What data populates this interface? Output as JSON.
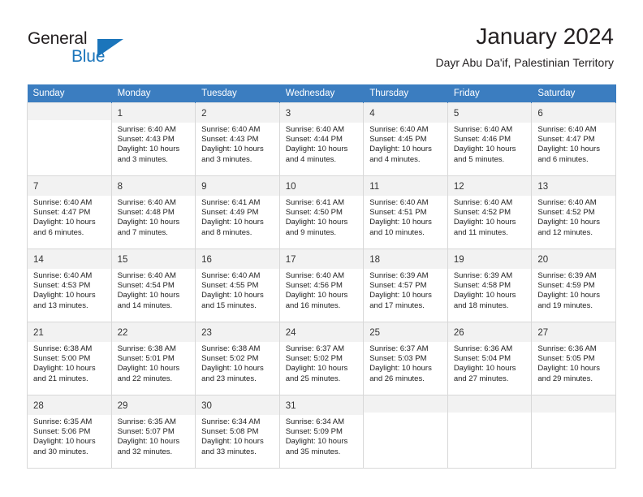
{
  "brand": {
    "name_part1": "General",
    "name_part2": "Blue",
    "accent_color": "#1b75bb"
  },
  "header": {
    "title": "January 2024",
    "subtitle": "Dayr Abu Da'if, Palestinian Territory"
  },
  "calendar": {
    "header_bg": "#3b7dc0",
    "daynum_bg": "#f2f2f2",
    "weekday_headers": [
      "Sunday",
      "Monday",
      "Tuesday",
      "Wednesday",
      "Thursday",
      "Friday",
      "Saturday"
    ],
    "weeks": [
      [
        {
          "day": "",
          "lines": []
        },
        {
          "day": "1",
          "lines": [
            "Sunrise: 6:40 AM",
            "Sunset: 4:43 PM",
            "Daylight: 10 hours",
            "and 3 minutes."
          ]
        },
        {
          "day": "2",
          "lines": [
            "Sunrise: 6:40 AM",
            "Sunset: 4:43 PM",
            "Daylight: 10 hours",
            "and 3 minutes."
          ]
        },
        {
          "day": "3",
          "lines": [
            "Sunrise: 6:40 AM",
            "Sunset: 4:44 PM",
            "Daylight: 10 hours",
            "and 4 minutes."
          ]
        },
        {
          "day": "4",
          "lines": [
            "Sunrise: 6:40 AM",
            "Sunset: 4:45 PM",
            "Daylight: 10 hours",
            "and 4 minutes."
          ]
        },
        {
          "day": "5",
          "lines": [
            "Sunrise: 6:40 AM",
            "Sunset: 4:46 PM",
            "Daylight: 10 hours",
            "and 5 minutes."
          ]
        },
        {
          "day": "6",
          "lines": [
            "Sunrise: 6:40 AM",
            "Sunset: 4:47 PM",
            "Daylight: 10 hours",
            "and 6 minutes."
          ]
        }
      ],
      [
        {
          "day": "7",
          "lines": [
            "Sunrise: 6:40 AM",
            "Sunset: 4:47 PM",
            "Daylight: 10 hours",
            "and 6 minutes."
          ]
        },
        {
          "day": "8",
          "lines": [
            "Sunrise: 6:40 AM",
            "Sunset: 4:48 PM",
            "Daylight: 10 hours",
            "and 7 minutes."
          ]
        },
        {
          "day": "9",
          "lines": [
            "Sunrise: 6:41 AM",
            "Sunset: 4:49 PM",
            "Daylight: 10 hours",
            "and 8 minutes."
          ]
        },
        {
          "day": "10",
          "lines": [
            "Sunrise: 6:41 AM",
            "Sunset: 4:50 PM",
            "Daylight: 10 hours",
            "and 9 minutes."
          ]
        },
        {
          "day": "11",
          "lines": [
            "Sunrise: 6:40 AM",
            "Sunset: 4:51 PM",
            "Daylight: 10 hours",
            "and 10 minutes."
          ]
        },
        {
          "day": "12",
          "lines": [
            "Sunrise: 6:40 AM",
            "Sunset: 4:52 PM",
            "Daylight: 10 hours",
            "and 11 minutes."
          ]
        },
        {
          "day": "13",
          "lines": [
            "Sunrise: 6:40 AM",
            "Sunset: 4:52 PM",
            "Daylight: 10 hours",
            "and 12 minutes."
          ]
        }
      ],
      [
        {
          "day": "14",
          "lines": [
            "Sunrise: 6:40 AM",
            "Sunset: 4:53 PM",
            "Daylight: 10 hours",
            "and 13 minutes."
          ]
        },
        {
          "day": "15",
          "lines": [
            "Sunrise: 6:40 AM",
            "Sunset: 4:54 PM",
            "Daylight: 10 hours",
            "and 14 minutes."
          ]
        },
        {
          "day": "16",
          "lines": [
            "Sunrise: 6:40 AM",
            "Sunset: 4:55 PM",
            "Daylight: 10 hours",
            "and 15 minutes."
          ]
        },
        {
          "day": "17",
          "lines": [
            "Sunrise: 6:40 AM",
            "Sunset: 4:56 PM",
            "Daylight: 10 hours",
            "and 16 minutes."
          ]
        },
        {
          "day": "18",
          "lines": [
            "Sunrise: 6:39 AM",
            "Sunset: 4:57 PM",
            "Daylight: 10 hours",
            "and 17 minutes."
          ]
        },
        {
          "day": "19",
          "lines": [
            "Sunrise: 6:39 AM",
            "Sunset: 4:58 PM",
            "Daylight: 10 hours",
            "and 18 minutes."
          ]
        },
        {
          "day": "20",
          "lines": [
            "Sunrise: 6:39 AM",
            "Sunset: 4:59 PM",
            "Daylight: 10 hours",
            "and 19 minutes."
          ]
        }
      ],
      [
        {
          "day": "21",
          "lines": [
            "Sunrise: 6:38 AM",
            "Sunset: 5:00 PM",
            "Daylight: 10 hours",
            "and 21 minutes."
          ]
        },
        {
          "day": "22",
          "lines": [
            "Sunrise: 6:38 AM",
            "Sunset: 5:01 PM",
            "Daylight: 10 hours",
            "and 22 minutes."
          ]
        },
        {
          "day": "23",
          "lines": [
            "Sunrise: 6:38 AM",
            "Sunset: 5:02 PM",
            "Daylight: 10 hours",
            "and 23 minutes."
          ]
        },
        {
          "day": "24",
          "lines": [
            "Sunrise: 6:37 AM",
            "Sunset: 5:02 PM",
            "Daylight: 10 hours",
            "and 25 minutes."
          ]
        },
        {
          "day": "25",
          "lines": [
            "Sunrise: 6:37 AM",
            "Sunset: 5:03 PM",
            "Daylight: 10 hours",
            "and 26 minutes."
          ]
        },
        {
          "day": "26",
          "lines": [
            "Sunrise: 6:36 AM",
            "Sunset: 5:04 PM",
            "Daylight: 10 hours",
            "and 27 minutes."
          ]
        },
        {
          "day": "27",
          "lines": [
            "Sunrise: 6:36 AM",
            "Sunset: 5:05 PM",
            "Daylight: 10 hours",
            "and 29 minutes."
          ]
        }
      ],
      [
        {
          "day": "28",
          "lines": [
            "Sunrise: 6:35 AM",
            "Sunset: 5:06 PM",
            "Daylight: 10 hours",
            "and 30 minutes."
          ]
        },
        {
          "day": "29",
          "lines": [
            "Sunrise: 6:35 AM",
            "Sunset: 5:07 PM",
            "Daylight: 10 hours",
            "and 32 minutes."
          ]
        },
        {
          "day": "30",
          "lines": [
            "Sunrise: 6:34 AM",
            "Sunset: 5:08 PM",
            "Daylight: 10 hours",
            "and 33 minutes."
          ]
        },
        {
          "day": "31",
          "lines": [
            "Sunrise: 6:34 AM",
            "Sunset: 5:09 PM",
            "Daylight: 10 hours",
            "and 35 minutes."
          ]
        },
        {
          "day": "",
          "lines": []
        },
        {
          "day": "",
          "lines": []
        },
        {
          "day": "",
          "lines": []
        }
      ]
    ]
  }
}
